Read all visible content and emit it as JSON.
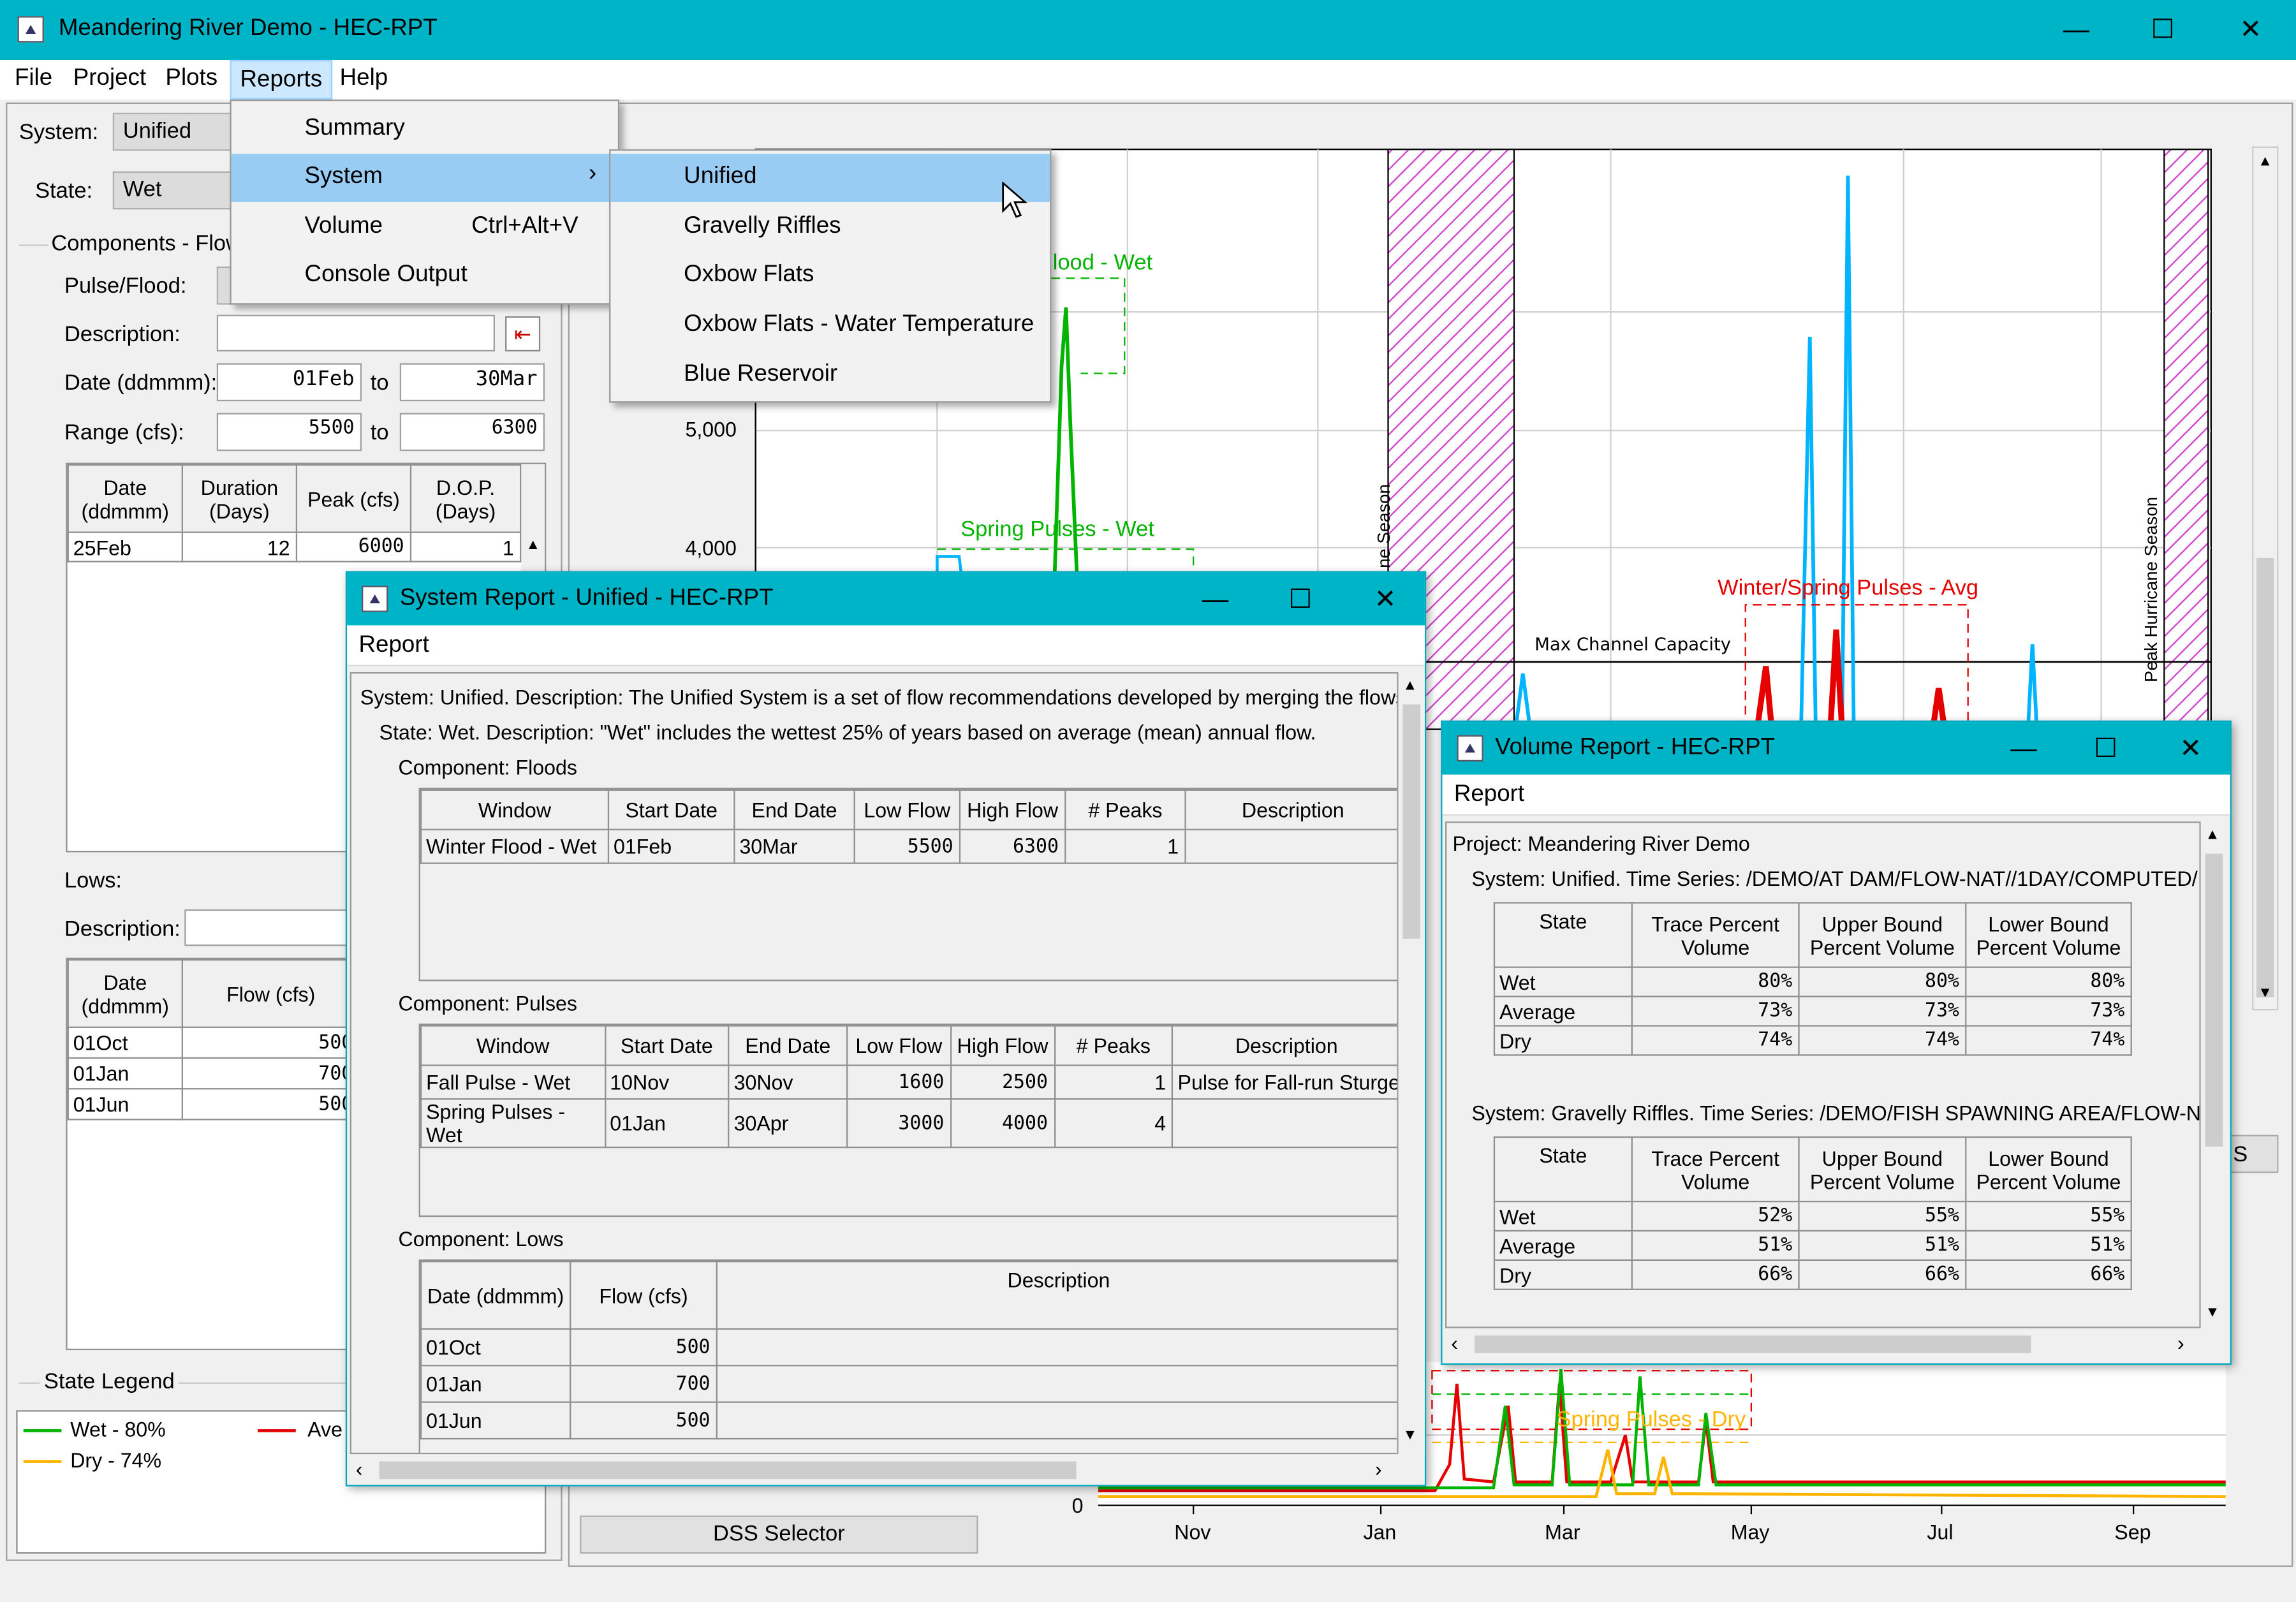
{
  "main": {
    "title": "Meandering River Demo - HEC-RPT",
    "menu": [
      "File",
      "Project",
      "Plots",
      "Reports",
      "Help"
    ]
  },
  "reports_menu": {
    "items": [
      {
        "label": "Summary",
        "shortcut": ""
      },
      {
        "label": "System",
        "shortcut": ""
      },
      {
        "label": "Volume",
        "shortcut": "Ctrl+Alt+V"
      },
      {
        "label": "Console Output",
        "shortcut": ""
      }
    ],
    "submenu": [
      "Unified",
      "Gravelly Riffles",
      "Oxbow Flats",
      "Oxbow Flats - Water Temperature",
      "Blue Reservoir"
    ]
  },
  "left": {
    "system_label": "System:",
    "system_value": "Unified",
    "state_label": "State:",
    "state_value": "Wet",
    "components_label": "Components - Flow",
    "pulseflood_label": "Pulse/Flood:",
    "description_label": "Description:",
    "date_label": "Date (ddmmm):",
    "date_from": "01Feb",
    "to": "to",
    "date_to": "30Mar",
    "range_label": "Range (cfs):",
    "range_from": "5500",
    "range_to": "6300",
    "flood_table": {
      "headers": [
        "Date (ddmmm)",
        "Duration (Days)",
        "Peak (cfs)",
        "D.O.P. (Days)"
      ],
      "rows": [
        [
          "25Feb",
          "12",
          "6000",
          "1"
        ]
      ]
    },
    "lows_label": "Lows:",
    "lows_desc_label": "Description:",
    "lows_table": {
      "headers": [
        "Date (ddmmm)",
        "Flow (cfs)"
      ],
      "rows": [
        [
          "01Oct",
          "500"
        ],
        [
          "01Jan",
          "700"
        ],
        [
          "01Jun",
          "500"
        ]
      ]
    },
    "legend_title": "State Legend",
    "legend": [
      {
        "label": "Wet - 80%",
        "color": "#00b400"
      },
      {
        "label": "Ave",
        "color": "#e60000"
      },
      {
        "label": "Dry - 74%",
        "color": "#ffb400"
      }
    ]
  },
  "chart": {
    "labels": {
      "flood_wet": "lood - Wet",
      "spring_wet": "Spring Pulses - Wet",
      "winter_avg": "Winter/Spring Pulses - Avg",
      "max_cap": "Max Channel Capacity",
      "season1": "ne Season",
      "season2": "Peak Hurricane Season",
      "spring_dry": "Spring Pulses - Dry"
    },
    "y_ticks": [
      "5,000",
      "4,000",
      "0"
    ],
    "x_ticks": [
      "Nov",
      "Jan",
      "Mar",
      "May",
      "Jul",
      "Sep"
    ],
    "dss_button": "DSS Selector",
    "s_btn": "S"
  },
  "system_report": {
    "title": "System Report - Unified - HEC-RPT",
    "menu": "Report",
    "line1": "System: Unified.  Description: The Unified System is a set of flow recommendations developed by merging the flows p",
    "line2": "State: Wet.  Description: \"Wet\" includes the wettest 25% of years based on average (mean) annual flow.",
    "floods_label": "Component: Floods",
    "comp_headers": [
      "Window",
      "Start Date",
      "End Date",
      "Low Flow",
      "High Flow",
      "# Peaks",
      "Description"
    ],
    "floods_rows": [
      [
        "Winter Flood - Wet",
        "01Feb",
        "30Mar",
        "5500",
        "6300",
        "1",
        ""
      ]
    ],
    "pulses_label": "Component: Pulses",
    "pulses_rows": [
      [
        "Fall Pulse - Wet",
        "10Nov",
        "30Nov",
        "1600",
        "2500",
        "1",
        "Pulse for Fall-run Sturge"
      ],
      [
        "Spring Pulses - Wet",
        "01Jan",
        "30Apr",
        "3000",
        "4000",
        "4",
        ""
      ]
    ],
    "lows_label": "Component: Lows",
    "lows_headers": [
      "Date (ddmmm)",
      "Flow (cfs)",
      "Description"
    ],
    "lows_rows": [
      [
        "01Oct",
        "500",
        ""
      ],
      [
        "01Jan",
        "700",
        ""
      ],
      [
        "01Jun",
        "500",
        ""
      ]
    ]
  },
  "volume_report": {
    "title": "Volume Report - HEC-RPT",
    "menu": "Report",
    "project": "Project: Meandering River Demo",
    "sys1": "System: Unified.  Time Series: /DEMO/AT DAM/FLOW-NAT//1DAY/COMPUTED/",
    "headers": [
      "State",
      "Trace Percent Volume",
      "Upper Bound Percent Volume",
      "Lower Bound Percent Volume"
    ],
    "rows1": [
      [
        "Wet",
        "80%",
        "80%",
        "80%"
      ],
      [
        "Average",
        "73%",
        "73%",
        "73%"
      ],
      [
        "Dry",
        "74%",
        "74%",
        "74%"
      ]
    ],
    "sys2": "System: Gravelly Riffles.  Time Series: /DEMO/FISH SPAWNING AREA/FLOW-NAT/",
    "rows2": [
      [
        "Wet",
        "52%",
        "55%",
        "55%"
      ],
      [
        "Average",
        "51%",
        "51%",
        "51%"
      ],
      [
        "Dry",
        "66%",
        "66%",
        "66%"
      ]
    ]
  }
}
